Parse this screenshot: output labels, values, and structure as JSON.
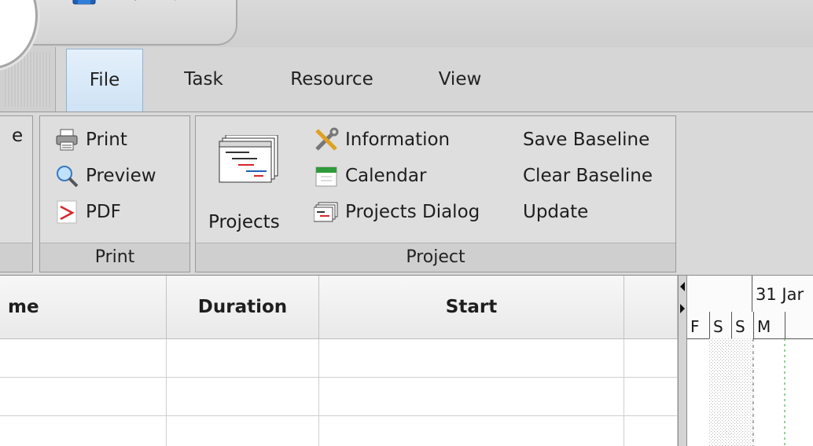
{
  "tabs": [
    {
      "label": "File",
      "active": true
    },
    {
      "label": "Task",
      "active": false
    },
    {
      "label": "Resource",
      "active": false
    },
    {
      "label": "View",
      "active": false
    }
  ],
  "ribbon": {
    "cut_group": {
      "partial_label": "e"
    },
    "print_group": {
      "label": "Print",
      "buttons": [
        {
          "label": "Print",
          "icon": "printer-icon"
        },
        {
          "label": "Preview",
          "icon": "magnifier-icon"
        },
        {
          "label": "PDF",
          "icon": "pdf-icon"
        }
      ]
    },
    "project_group": {
      "label": "Project",
      "large_button": {
        "label": "Projects",
        "icon": "projects-gantt-icon"
      },
      "buttons": [
        {
          "label": "Information",
          "icon": "tools-icon"
        },
        {
          "label": "Calendar",
          "icon": "calendar-icon"
        },
        {
          "label": "Projects Dialog",
          "icon": "projects-dialog-icon"
        }
      ],
      "baseline_buttons": [
        {
          "label": "Save Baseline"
        },
        {
          "label": "Clear Baseline"
        },
        {
          "label": "Update"
        }
      ]
    }
  },
  "grid": {
    "columns": [
      "me",
      "Duration",
      "Start",
      ""
    ]
  },
  "gantt": {
    "week_label": "31 Jar",
    "days": [
      "F",
      "S",
      "S",
      "M"
    ]
  },
  "colors": {
    "accent_tab": "#cfe3f5",
    "today_line": "#2ca02c"
  }
}
